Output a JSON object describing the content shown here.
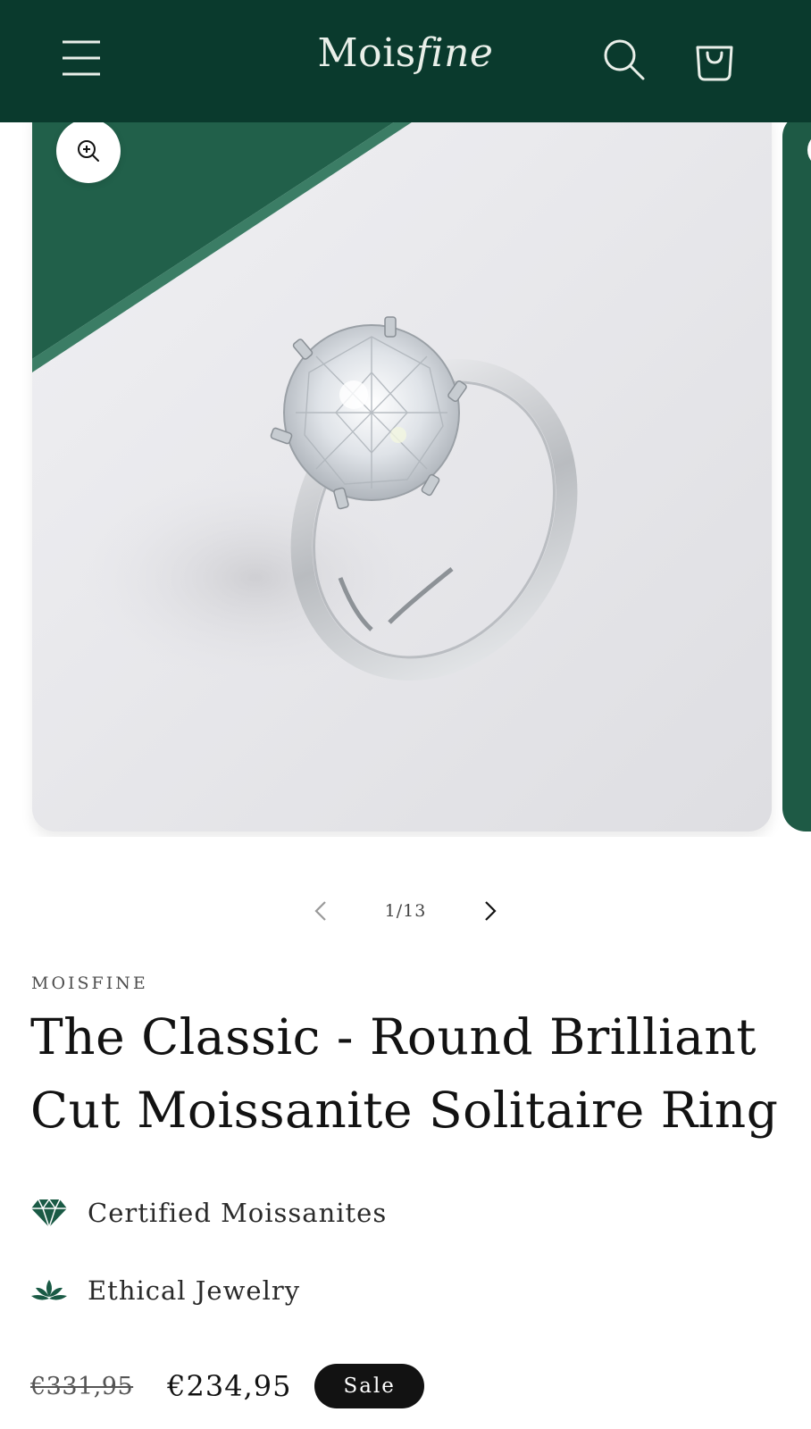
{
  "header": {
    "logo_part1": "Mois",
    "logo_part2": "fine",
    "icons": [
      "menu-icon",
      "search-icon",
      "cart-icon"
    ],
    "background_color": "#0a3a2d"
  },
  "gallery": {
    "counter": "1/13",
    "icons": [
      "zoom-in-icon",
      "chevron-left-icon",
      "chevron-right-icon"
    ]
  },
  "product": {
    "vendor": "MOISFINE",
    "title": "The Classic - Round Brilliant Cut Moissanite Solitaire Ring",
    "features": [
      {
        "icon": "diamond-icon",
        "label": "Certified Moissanites"
      },
      {
        "icon": "lotus-icon",
        "label": "Ethical Jewelry"
      }
    ],
    "original_price": "€331,95",
    "sale_price": "€234,95",
    "sale_badge": "Sale",
    "accent_color": "#1a5a45"
  }
}
